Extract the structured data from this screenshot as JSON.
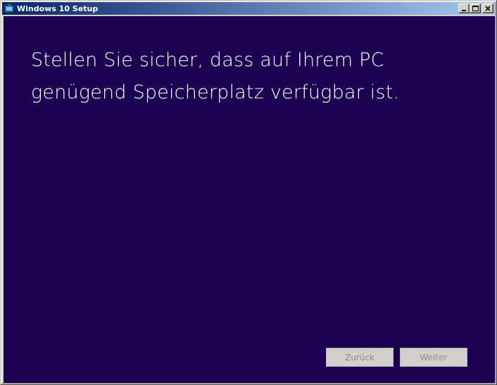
{
  "window": {
    "title": "Windows 10 Setup",
    "icon": "setup-app-icon"
  },
  "titlebar_buttons": {
    "minimize_icon": "minimize-icon",
    "maximize_icon": "maximize-icon",
    "close_icon": "close-icon"
  },
  "main": {
    "heading": "Stellen Sie sicher, dass auf Ihrem PC genügend Speicherplatz verfügbar ist."
  },
  "footer": {
    "back_label": "Zurück",
    "next_label": "Weiter",
    "back_enabled": false,
    "next_enabled": false
  },
  "colors": {
    "content_background": "#1c0052",
    "titlebar_start": "#0a246a",
    "titlebar_end": "#a6caf0",
    "disabled_button_text": "#8e8c89"
  }
}
